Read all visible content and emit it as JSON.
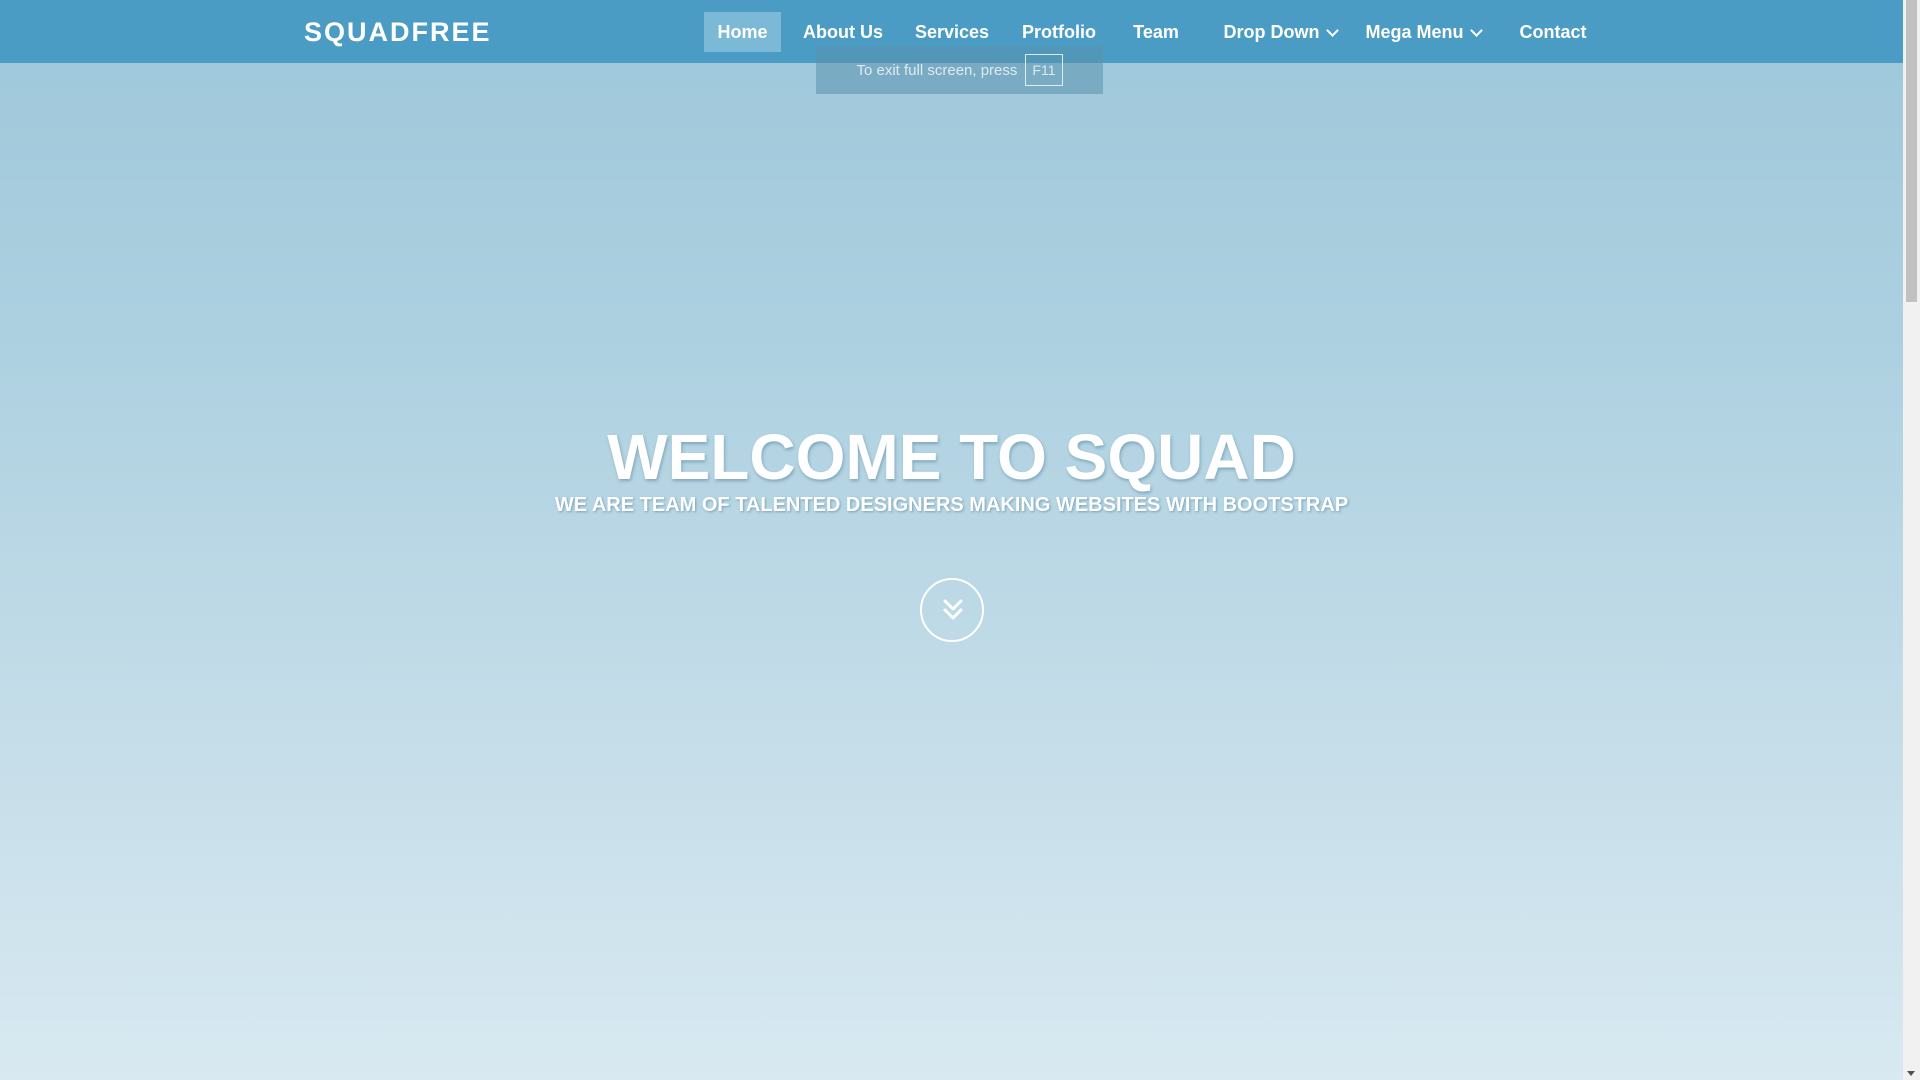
{
  "brand": "SQUADFREE",
  "nav": {
    "items": [
      {
        "label": "Home"
      },
      {
        "label": "About Us"
      },
      {
        "label": "Services"
      },
      {
        "label": "Protfolio"
      },
      {
        "label": "Team"
      },
      {
        "label": "Drop Down"
      },
      {
        "label": "Mega Menu"
      },
      {
        "label": "Contact"
      }
    ]
  },
  "fullscreen_notice": {
    "text": "To exit full screen, press",
    "key": "F11"
  },
  "hero": {
    "title": "WELCOME TO SQUAD",
    "subtitle": "WE ARE TEAM OF TALENTED DESIGNERS MAKING WEBSITES WITH BOOTSTRAP"
  },
  "icons": {
    "scroll_down": "double-chevron-down-icon",
    "dropdown": "chevron-down-icon"
  },
  "colors": {
    "navbar": "#4b9cc4",
    "active_item": "#7cb9d6",
    "hero_top": "#9dc7da",
    "hero_bottom": "#d8e9f1"
  }
}
